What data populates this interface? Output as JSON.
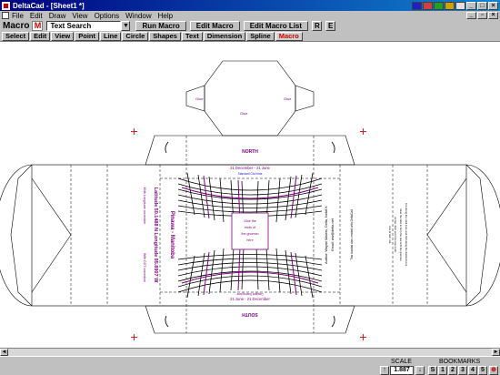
{
  "window": {
    "title": "DeltaCad - [Sheet1 *]"
  },
  "menu": [
    "File",
    "Edit",
    "Draw",
    "View",
    "Options",
    "Window",
    "Help"
  ],
  "toolbar": {
    "label": "Macro",
    "badge": "M",
    "search_value": "Text Search",
    "buttons": [
      "Run Macro",
      "Edit Macro",
      "Edit Macro List"
    ],
    "small_buttons": [
      "R",
      "E"
    ]
  },
  "tabs": [
    "Select",
    "Edit",
    "View",
    "Point",
    "Line",
    "Circle",
    "Shapes",
    "Text",
    "Dimension",
    "Spline",
    "Macro"
  ],
  "active_tab": "Macro",
  "drawing": {
    "north": "NORTH",
    "south": "SOUTH",
    "date_top": "21 December - 21 June",
    "standard_time": "Standard Civil time",
    "date_bottom": "21 June - 21 December",
    "daylight_time": "Daylight Saving time",
    "center_note": [
      "Glue the",
      "ends of",
      "the gnomon",
      "here"
    ],
    "glue": "Glue",
    "city": "Pinawa - Manitoba",
    "latlong": "Latitude 50.1488 N   Longitude 95.8907 W",
    "long_corr": "With Longitude correction",
    "dst_corr": "With DST correction",
    "author": "Author: Wayne Waters, Delta, Nebrt K",
    "email": "Email: ww@delta.net",
    "credit": "This sundial was created with DeltaCad",
    "right_text": [
      "Cut along the solid lines and fold along the dashed lines.",
      "Glue the tabs to form the box with the gnomon",
      "on top, then point the box north.",
      "Use at own risk."
    ]
  },
  "status": {
    "scale_label": "SCALE",
    "scale_value": "1.887",
    "bookmarks_label": "BOOKMARKS",
    "bookmarks": [
      "S",
      "1",
      "2",
      "3",
      "4",
      "5"
    ]
  },
  "colors": {
    "accent": "#d00000",
    "drawing_purple": "#800080",
    "title_bar": "#000080"
  }
}
